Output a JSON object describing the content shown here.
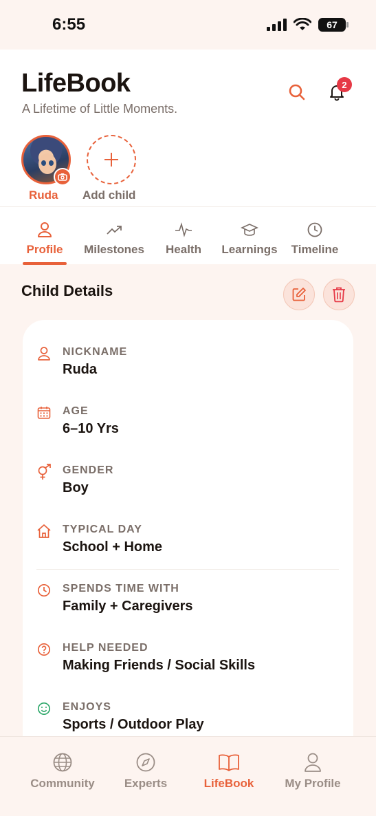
{
  "status_bar": {
    "time": "6:55",
    "battery": "67"
  },
  "header": {
    "title": "LifeBook",
    "subtitle": "A Lifetime of Little Moments.",
    "notification_count": "2"
  },
  "children": {
    "selected_name": "Ruda",
    "add_label": "Add child"
  },
  "tabs": [
    {
      "label": "Profile",
      "icon": "user-icon",
      "active": true
    },
    {
      "label": "Milestones",
      "icon": "trending-up-icon"
    },
    {
      "label": "Health",
      "icon": "pulse-icon"
    },
    {
      "label": "Learnings",
      "icon": "graduation-cap-icon"
    },
    {
      "label": "Timeline",
      "icon": "clock-icon"
    }
  ],
  "section": {
    "title": "Child Details"
  },
  "details": [
    {
      "label": "NICKNAME",
      "value": "Ruda",
      "icon": "user-icon"
    },
    {
      "label": "AGE",
      "value": "6–10 Yrs",
      "icon": "calendar-icon"
    },
    {
      "label": "GENDER",
      "value": "Boy",
      "icon": "gender-icon"
    },
    {
      "label": "TYPICAL DAY",
      "value": "School + Home",
      "icon": "home-icon"
    },
    {
      "label": "SPENDS TIME WITH",
      "value": "Family + Caregivers",
      "icon": "clock-icon"
    },
    {
      "label": "HELP NEEDED",
      "value": "Making Friends / Social Skills",
      "icon": "help-circle-icon"
    },
    {
      "label": "ENJOYS",
      "value": "Sports / Outdoor Play",
      "icon": "smile-icon"
    }
  ],
  "bottom_nav": [
    {
      "label": "Community",
      "icon": "globe-icon"
    },
    {
      "label": "Experts",
      "icon": "compass-icon"
    },
    {
      "label": "LifeBook",
      "icon": "book-icon",
      "active": true
    },
    {
      "label": "My Profile",
      "icon": "user-icon"
    }
  ],
  "colors": {
    "accent": "#e8613a",
    "muted_text": "#7a6e68",
    "badge": "#e63946",
    "background": "#fdf4f0"
  }
}
